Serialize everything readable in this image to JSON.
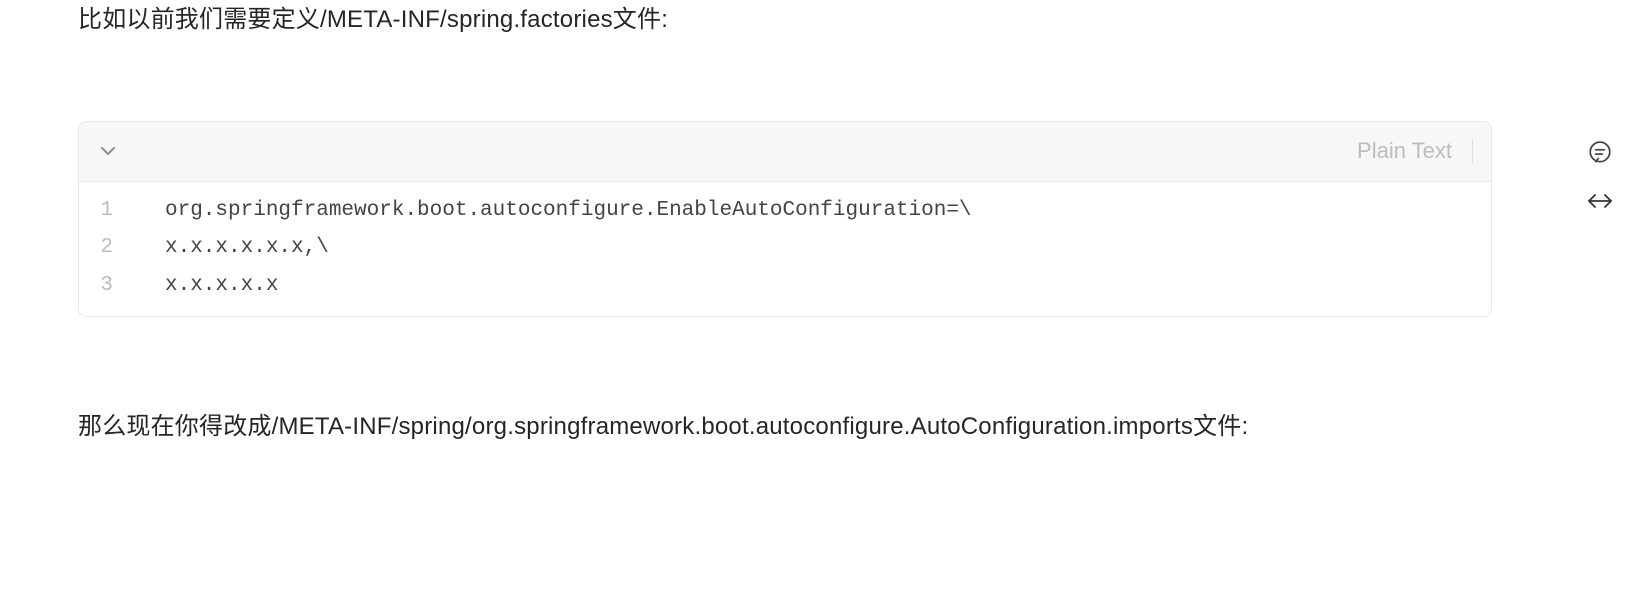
{
  "para_top": "比如以前我们需要定义/META-INF/spring.factories文件:",
  "codeblock": {
    "language_label": "Plain Text",
    "lines": [
      "org.springframework.boot.autoconfigure.EnableAutoConfiguration=\\",
      "x.x.x.x.x.x,\\",
      "x.x.x.x.x"
    ]
  },
  "para_bottom": "那么现在你得改成/META-INF/spring/org.springframework.boot.autoconfigure.AutoConfiguration.imports文件:",
  "rail": {
    "comment_label": "comment",
    "expand_label": "expand"
  }
}
